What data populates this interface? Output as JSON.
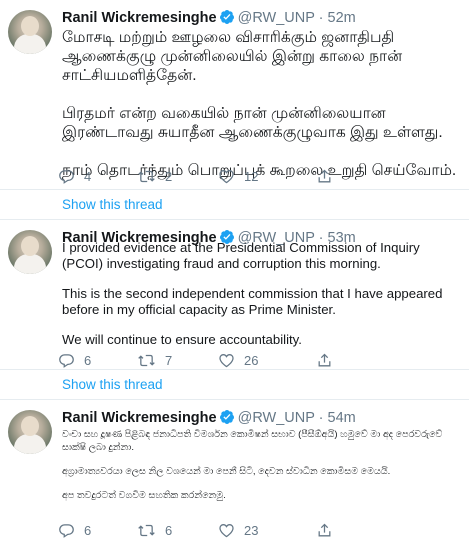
{
  "tweets": [
    {
      "name": "Ranil Wickremesinghe",
      "handle": "@RW_UNP",
      "dot": "·",
      "time": "52m",
      "paragraphs": [
        "மோசடி மற்றும் ஊழலை விசாரிக்கும் ஜனாதிபதி ஆணைக்குழு முன்னிலையில் இன்று காலை நான் சாட்சியமளித்தேன்.",
        "பிரதமர் என்ற வகையில் நான் முன்னிலையான இரண்டாவது சுயாதீன ஆணைக்குழுவாக இது உள்ளது.",
        "நாம் தொடர்ந்தும் பொறுப்புக் கூறலை உறுதி செய்வோம்."
      ],
      "replies": "4",
      "retweets": "2",
      "likes": "12"
    },
    {
      "name": "Ranil Wickremesinghe",
      "handle": "@RW_UNP",
      "dot": "·",
      "time": "53m",
      "paragraphs": [
        "I provided evidence at the Presidential Commission of Inquiry (PCOI) investigating fraud and corruption this morning.",
        "This is the second independent commission that I have appeared before in my official capacity as Prime Minister.",
        "We will continue to ensure accountability."
      ],
      "replies": "6",
      "retweets": "7",
      "likes": "26"
    },
    {
      "name": "Ranil Wickremesinghe",
      "handle": "@RW_UNP",
      "dot": "·",
      "time": "54m",
      "paragraphs": [
        "වංචා සහ දූෂණ පිළිබඳ ජනාධිපති විමර්ශන කොමිෂන් සභාව (පීසීඕඅයි) හමුවේ මා අද පෙරවරුවේ සාක්ෂි ලබා දුන්නා.",
        "අග්‍රාමාත්‍යවරයා ලෙස නිල වශයෙන් මා පෙනී සිටි, දෙවන ස්වාධීන කොමිසම මෙයයි.",
        "අප තවදුරටත් වගවීම සහතික කරන්නෙමු."
      ],
      "replies": "6",
      "retweets": "6",
      "likes": "23"
    }
  ],
  "show_thread_label": "Show this thread",
  "colors": {
    "accent": "#1da1f2",
    "secondary_text": "#657786",
    "divider": "#e6ecf0"
  },
  "icons": [
    "verified-badge-icon",
    "reply-icon",
    "retweet-icon",
    "like-icon",
    "share-icon"
  ]
}
